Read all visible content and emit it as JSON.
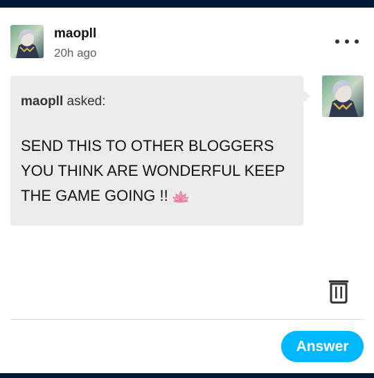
{
  "post": {
    "username": "maopll",
    "timestamp": "20h ago",
    "more_icon": "more-horizontal-icon"
  },
  "ask": {
    "asker_name": "maopll",
    "asked_label": "asked:",
    "question": "SEND THIS TO OTHER BLOGGERS YOU THINK ARE WONDERFUL KEEP THE GAME GOING !!",
    "emoji": "lotus-icon"
  },
  "actions": {
    "delete_icon": "trash-icon",
    "answer_label": "Answer"
  },
  "colors": {
    "page_frame": "#001935",
    "accent": "#00b8ff",
    "bubble": "#ececec"
  }
}
